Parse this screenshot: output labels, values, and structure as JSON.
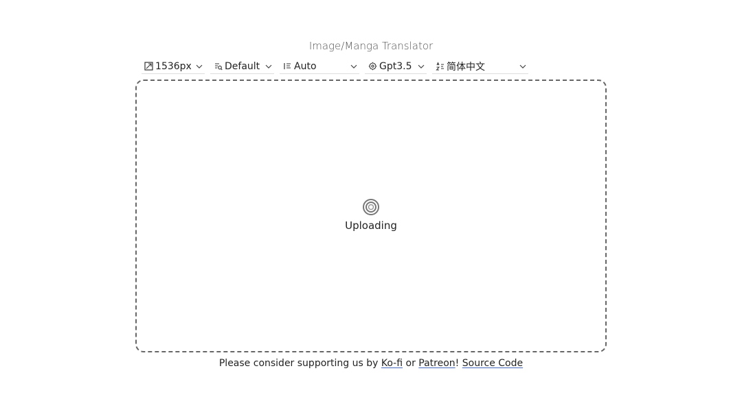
{
  "app": {
    "title": "Image/Manga Translator"
  },
  "toolbar": {
    "size": {
      "value": "1536px",
      "icon": "resize-icon"
    },
    "detector": {
      "value": "Default",
      "icon": "detector-icon"
    },
    "direction": {
      "value": "Auto",
      "icon": "text-direction-icon"
    },
    "translator": {
      "value": "Gpt3.5",
      "icon": "translator-icon"
    },
    "target_language": {
      "value": "简体中文",
      "icon": "language-icon"
    }
  },
  "dropzone": {
    "status": "Uploading",
    "status_icon": "spinner-icon"
  },
  "footer": {
    "prefix": "Please consider supporting us by",
    "kofi": "Ko-fi",
    "or": "or",
    "patreon": "Patreon",
    "exclaim": "!",
    "source": "Source Code"
  },
  "colors": {
    "border": "#666666",
    "link_underline": "#4466bb",
    "text": "#222222"
  }
}
